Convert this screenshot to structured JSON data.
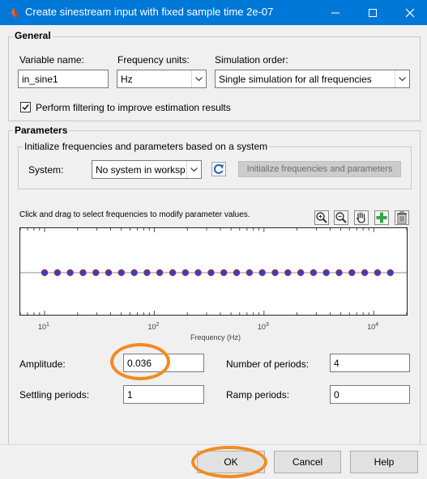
{
  "window": {
    "title": "Create sinestream input with fixed sample time 2e-07",
    "minimize_glyph": "—",
    "maximize_glyph": "□",
    "close_glyph": "✕"
  },
  "general": {
    "title": "General",
    "variable_name": {
      "label": "Variable name:",
      "value": "in_sine1"
    },
    "frequency_units": {
      "label": "Frequency units:",
      "value": "Hz"
    },
    "simulation_order": {
      "label": "Simulation order:",
      "value": "Single simulation for all frequencies"
    },
    "filtering": {
      "label": "Perform filtering to improve estimation results",
      "checked": true
    }
  },
  "parameters": {
    "title": "Parameters",
    "init_group": {
      "title": "Initialize frequencies and parameters based on a system",
      "system_label": "System:",
      "system_value": "No system in worksp...",
      "init_button": "Initialize frequencies and parameters",
      "refresh_icon": "refresh-icon"
    },
    "instruction": "Click and drag to select frequencies to modify parameter values.",
    "toolbar_icons": [
      "zoom-in-icon",
      "zoom-out-icon",
      "pan-hand-icon",
      "add-frequency-icon",
      "delete-icon"
    ],
    "amplitude": {
      "label": "Amplitude:",
      "value": "0.036"
    },
    "number_of_periods": {
      "label": "Number of periods:",
      "value": "4"
    },
    "settling_periods": {
      "label": "Settling periods:",
      "value": "1"
    },
    "ramp_periods": {
      "label": "Ramp periods:",
      "value": "0"
    }
  },
  "chart_data": {
    "type": "scatter",
    "x_scale": "log",
    "xlim": [
      6,
      20000
    ],
    "xlabel": "Frequency (Hz)",
    "x_ticks": [
      {
        "base": "10",
        "exp": "1"
      },
      {
        "base": "10",
        "exp": "2"
      },
      {
        "base": "10",
        "exp": "3"
      },
      {
        "base": "10",
        "exp": "4"
      }
    ],
    "points_x": [
      10,
      13.1,
      17.1,
      22.4,
      29.3,
      38.3,
      50.1,
      65.6,
      85.8,
      112,
      147,
      192,
      251,
      329,
      430,
      563,
      737,
      964,
      1261,
      1650,
      2159,
      2825,
      3696,
      4836,
      6328,
      8280,
      10834,
      14175
    ],
    "point_color": "#2e3de0",
    "point_edge": "#a0303a",
    "line_color": "#8c8c8c"
  },
  "footer": {
    "ok": "OK",
    "cancel": "Cancel",
    "help": "Help"
  },
  "annotations": {
    "highlight_color": "#f48a1e"
  }
}
